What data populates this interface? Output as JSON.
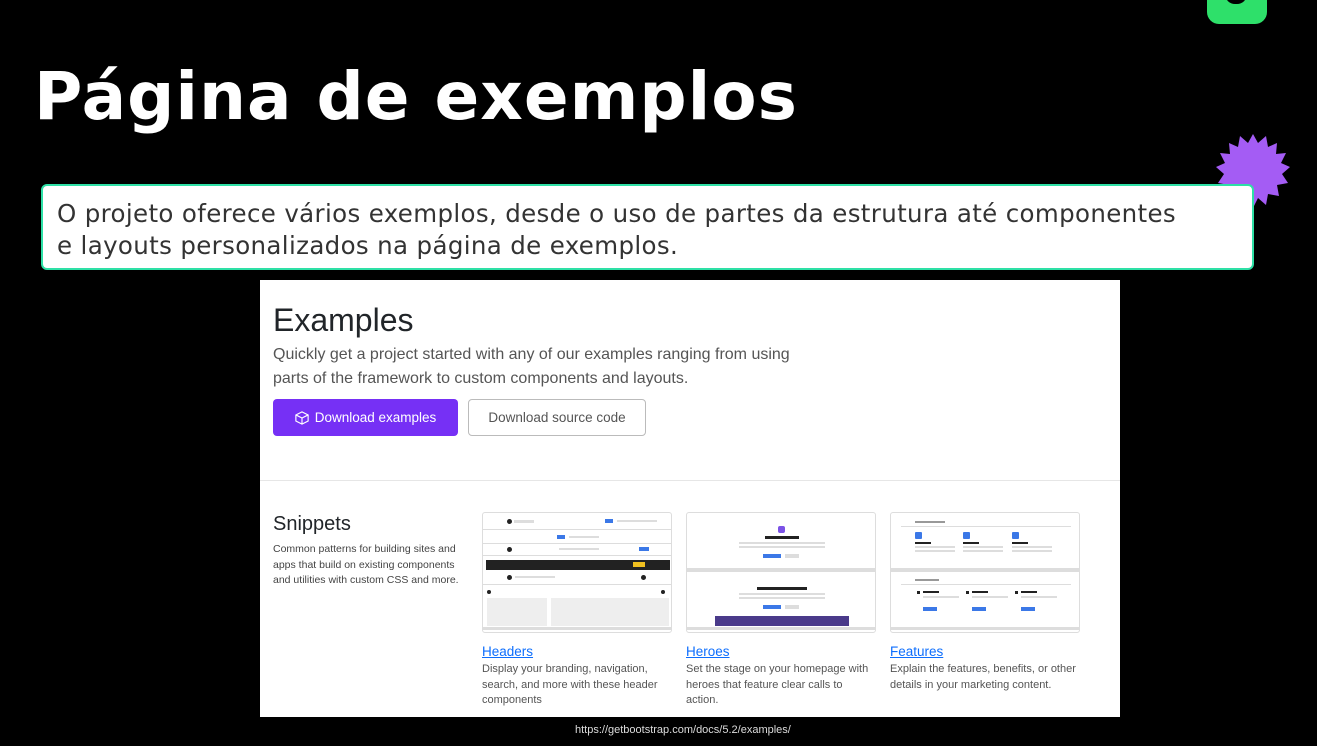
{
  "slide": {
    "title": "Página de exemplos",
    "intro_line1": "O projeto oferece vários exemplos, desde o uso de partes da estrutura até componentes",
    "intro_line2": "e layouts personalizados na página de exemplos.",
    "source_url": "https://getbootstrap.com/docs/5.2/examples/"
  },
  "page": {
    "heading": "Examples",
    "lead_line1": "Quickly get a project started with any of our examples ranging from using",
    "lead_line2": "parts of the framework to custom components and layouts.",
    "download_examples_label": "Download examples",
    "download_source_label": "Download source code"
  },
  "snippets": {
    "title": "Snippets",
    "description": "Common patterns for building sites and apps that build on existing components and utilities with custom CSS and more.",
    "cards": [
      {
        "title": "Headers",
        "description": "Display your branding, navigation, search, and more with these header components"
      },
      {
        "title": "Heroes",
        "description": "Set the stage on your homepage with heroes that feature clear calls to action."
      },
      {
        "title": "Features",
        "description": "Explain the features, benefits, or other details in your marketing content."
      }
    ]
  },
  "colors": {
    "accent_green": "#2ee06a",
    "accent_purple": "#7630f5",
    "link_blue": "#0d6efd",
    "star_purple": "#a45cf4"
  },
  "icons": [
    "brand-logo-icon",
    "starburst-icon",
    "box-icon"
  ]
}
